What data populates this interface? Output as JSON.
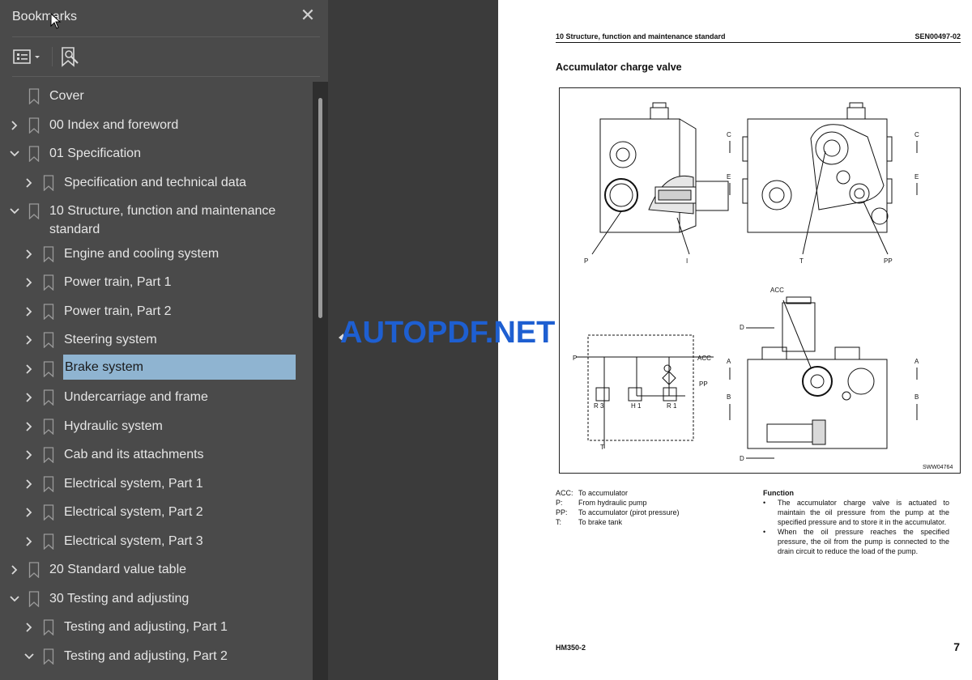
{
  "sidebar": {
    "title": "Bookmarks",
    "close_icon": "✕",
    "items": [
      {
        "label": "Cover",
        "level": 0,
        "state": "none"
      },
      {
        "label": "00 Index and foreword",
        "level": 0,
        "state": "collapsed"
      },
      {
        "label": "01 Specification",
        "level": 0,
        "state": "expanded"
      },
      {
        "label": "Specification and technical data",
        "level": 1,
        "state": "collapsed"
      },
      {
        "label": "10 Structure, function and maintenance standard",
        "level": 0,
        "state": "expanded"
      },
      {
        "label": "Engine and cooling system",
        "level": 1,
        "state": "collapsed"
      },
      {
        "label": "Power train, Part 1",
        "level": 1,
        "state": "collapsed"
      },
      {
        "label": "Power train, Part 2",
        "level": 1,
        "state": "collapsed"
      },
      {
        "label": "Steering system",
        "level": 1,
        "state": "collapsed"
      },
      {
        "label": "Brake system",
        "level": 1,
        "state": "collapsed",
        "selected": true
      },
      {
        "label": "Undercarriage and frame",
        "level": 1,
        "state": "collapsed"
      },
      {
        "label": "Hydraulic system",
        "level": 1,
        "state": "collapsed"
      },
      {
        "label": "Cab and its attachments",
        "level": 1,
        "state": "collapsed"
      },
      {
        "label": "Electrical system, Part 1",
        "level": 1,
        "state": "collapsed"
      },
      {
        "label": "Electrical system, Part 2",
        "level": 1,
        "state": "collapsed"
      },
      {
        "label": "Electrical system, Part 3",
        "level": 1,
        "state": "collapsed"
      },
      {
        "label": "20 Standard value table",
        "level": 0,
        "state": "collapsed"
      },
      {
        "label": "30 Testing and adjusting",
        "level": 0,
        "state": "expanded"
      },
      {
        "label": "Testing and adjusting, Part 1",
        "level": 1,
        "state": "collapsed"
      },
      {
        "label": "Testing and adjusting, Part 2",
        "level": 1,
        "state": "expanded"
      }
    ]
  },
  "document": {
    "header_left": "10 Structure, function and maintenance standard",
    "header_right": "SEN00497-02",
    "title": "Accumulator charge valve",
    "figure_code": "SWW04764",
    "figure_labels": {
      "c": "C",
      "e": "E",
      "p": "P",
      "i": "I",
      "t": "T",
      "pp": "PP",
      "acc": "ACC",
      "d": "D",
      "a": "A",
      "b": "B",
      "r3": "R 3",
      "h1": "H 1",
      "r1": "R 1"
    },
    "legend": [
      {
        "key": "ACC:",
        "text": "To accumulator"
      },
      {
        "key": "P:",
        "text": "From hydraulic pump"
      },
      {
        "key": "PP:",
        "text": "To accumulator (pirot pressure)"
      },
      {
        "key": "T:",
        "text": "To brake tank"
      }
    ],
    "function_heading": "Function",
    "function_bullets": [
      "The accumulator charge valve is actuated to maintain the oil pressure from the pump at the specified pressure and to store it in the accumulator.",
      "When the oil pressure reaches the specified pressure, the oil from the pump is connected to the drain circuit to reduce the load of the pump."
    ],
    "bullet_char": "•",
    "footer_left": "HM350-2",
    "footer_right": "7"
  },
  "watermark": "AUTOPDF.NET",
  "colors": {
    "sidebar_bg": "#4a4a4a",
    "selection": "#8fb4d1",
    "watermark": "#1e5fd1"
  }
}
